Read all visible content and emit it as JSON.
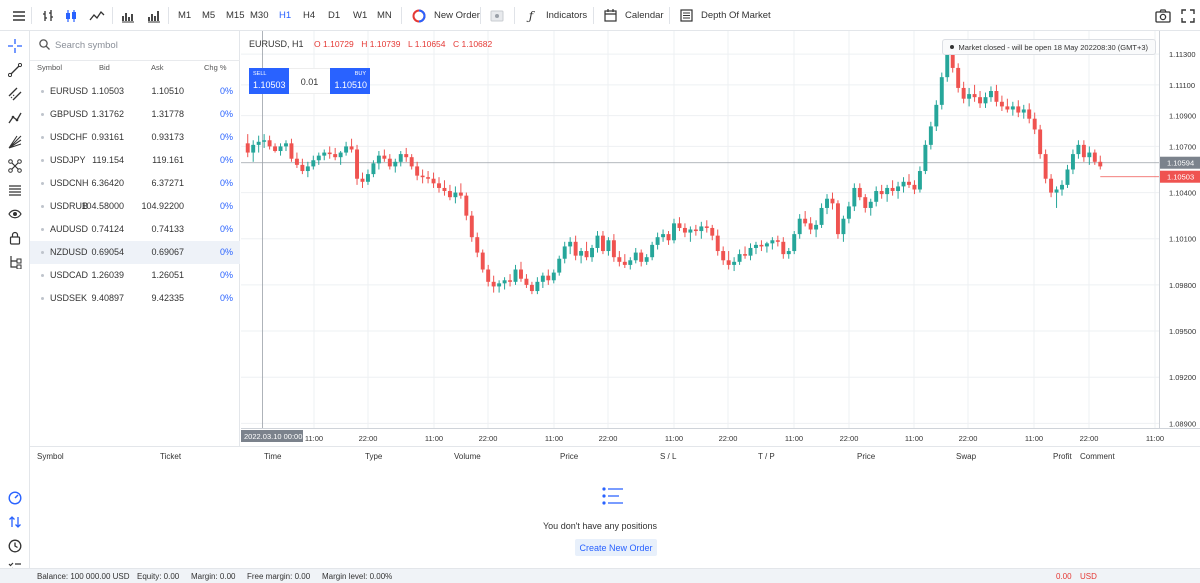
{
  "toolbar": {
    "timeframes": [
      "M1",
      "M5",
      "M15",
      "M30",
      "H1",
      "H4",
      "D1",
      "W1",
      "MN"
    ],
    "active_timeframe": "H1",
    "new_order_label": "New Order",
    "indicators_label": "Indicators",
    "calendar_label": "Calendar",
    "depth_label": "Depth Of Market"
  },
  "search": {
    "placeholder": "Search symbol"
  },
  "watchlist": {
    "headers": {
      "symbol": "Symbol",
      "bid": "Bid",
      "ask": "Ask",
      "chg": "Chg %"
    },
    "selected_symbol": "NZDUSD",
    "rows": [
      {
        "symbol": "EURUSD",
        "bid": "1.10503",
        "ask": "1.10510",
        "chg": "0%"
      },
      {
        "symbol": "GBPUSD",
        "bid": "1.31762",
        "ask": "1.31778",
        "chg": "0%"
      },
      {
        "symbol": "USDCHF",
        "bid": "0.93161",
        "ask": "0.93173",
        "chg": "0%"
      },
      {
        "symbol": "USDJPY",
        "bid": "119.154",
        "ask": "119.161",
        "chg": "0%"
      },
      {
        "symbol": "USDCNH",
        "bid": "6.36420",
        "ask": "6.37271",
        "chg": "0%"
      },
      {
        "symbol": "USDRUB",
        "bid": "104.58000",
        "ask": "104.92200",
        "chg": "0%"
      },
      {
        "symbol": "AUDUSD",
        "bid": "0.74124",
        "ask": "0.74133",
        "chg": "0%"
      },
      {
        "symbol": "NZDUSD",
        "bid": "0.69054",
        "ask": "0.69067",
        "chg": "0%"
      },
      {
        "symbol": "USDCAD",
        "bid": "1.26039",
        "ask": "1.26051",
        "chg": "0%"
      },
      {
        "symbol": "USDSEK",
        "bid": "9.40897",
        "ask": "9.42335",
        "chg": "0%"
      }
    ]
  },
  "chart": {
    "symbol_title": "EURUSD, H1",
    "ohlc": {
      "o": "O 1.10729",
      "h": "H 1.10739",
      "l": "L 1.10654",
      "c": "C 1.10682"
    },
    "market_status": "Market closed - will be open 18 May 202208:30 (GMT+3)",
    "sell_label": "SELL",
    "sell_price": "1.10503",
    "buy_label": "BUY",
    "buy_price": "1.10510",
    "volume": "0.01",
    "crosshair_date": "2022.03.10 00:00",
    "crosshair_price": "1.10594",
    "last_price": "1.10503"
  },
  "chart_data": {
    "type": "candlestick",
    "symbol": "EURUSD",
    "timeframe": "H1",
    "y_ticks": [
      "1.11300",
      "1.11100",
      "1.10900",
      "1.10700",
      "1.10400",
      "1.10100",
      "1.09800",
      "1.09500",
      "1.09200",
      "1.08900"
    ],
    "x_ticks": [
      "11:00",
      "22:00",
      "11:00",
      "22:00",
      "11:00",
      "22:00",
      "11:00",
      "22:00",
      "11:00",
      "22:00",
      "11:00",
      "22:00",
      "11:00",
      "22:00",
      "11:00"
    ],
    "ylim": [
      1.0887,
      1.1145
    ],
    "candles": [
      {
        "o": 1.1072,
        "h": 1.1078,
        "l": 1.1063,
        "c": 1.1066
      },
      {
        "o": 1.1066,
        "h": 1.1074,
        "l": 1.106,
        "c": 1.1071
      },
      {
        "o": 1.1071,
        "h": 1.1077,
        "l": 1.1066,
        "c": 1.1073
      },
      {
        "o": 1.1073,
        "h": 1.1078,
        "l": 1.1069,
        "c": 1.1074
      },
      {
        "o": 1.1074,
        "h": 1.1077,
        "l": 1.1068,
        "c": 1.107
      },
      {
        "o": 1.107,
        "h": 1.1072,
        "l": 1.1066,
        "c": 1.1067
      },
      {
        "o": 1.1067,
        "h": 1.1072,
        "l": 1.1064,
        "c": 1.107
      },
      {
        "o": 1.107,
        "h": 1.1074,
        "l": 1.1067,
        "c": 1.1072
      },
      {
        "o": 1.1072,
        "h": 1.1075,
        "l": 1.106,
        "c": 1.1062
      },
      {
        "o": 1.1062,
        "h": 1.1066,
        "l": 1.1056,
        "c": 1.1058
      },
      {
        "o": 1.1058,
        "h": 1.1062,
        "l": 1.1052,
        "c": 1.1054
      },
      {
        "o": 1.1054,
        "h": 1.106,
        "l": 1.105,
        "c": 1.1057
      },
      {
        "o": 1.1057,
        "h": 1.1064,
        "l": 1.1055,
        "c": 1.1061
      },
      {
        "o": 1.1061,
        "h": 1.1066,
        "l": 1.1058,
        "c": 1.1064
      },
      {
        "o": 1.1064,
        "h": 1.1068,
        "l": 1.1061,
        "c": 1.1066
      },
      {
        "o": 1.1066,
        "h": 1.107,
        "l": 1.1062,
        "c": 1.1065
      },
      {
        "o": 1.1065,
        "h": 1.1069,
        "l": 1.1061,
        "c": 1.1063
      },
      {
        "o": 1.1063,
        "h": 1.1067,
        "l": 1.1058,
        "c": 1.1066
      },
      {
        "o": 1.1066,
        "h": 1.1073,
        "l": 1.1064,
        "c": 1.107
      },
      {
        "o": 1.107,
        "h": 1.1075,
        "l": 1.1066,
        "c": 1.1068
      },
      {
        "o": 1.1068,
        "h": 1.1071,
        "l": 1.1045,
        "c": 1.1049
      },
      {
        "o": 1.1049,
        "h": 1.1053,
        "l": 1.1043,
        "c": 1.1047
      },
      {
        "o": 1.1047,
        "h": 1.1055,
        "l": 1.1045,
        "c": 1.1052
      },
      {
        "o": 1.1052,
        "h": 1.1061,
        "l": 1.105,
        "c": 1.1059
      },
      {
        "o": 1.1059,
        "h": 1.1067,
        "l": 1.1055,
        "c": 1.1064
      },
      {
        "o": 1.1064,
        "h": 1.1068,
        "l": 1.106,
        "c": 1.1062
      },
      {
        "o": 1.1062,
        "h": 1.1065,
        "l": 1.1055,
        "c": 1.1057
      },
      {
        "o": 1.1057,
        "h": 1.1062,
        "l": 1.1053,
        "c": 1.106
      },
      {
        "o": 1.106,
        "h": 1.1067,
        "l": 1.1057,
        "c": 1.1065
      },
      {
        "o": 1.1065,
        "h": 1.1069,
        "l": 1.106,
        "c": 1.1063
      },
      {
        "o": 1.1063,
        "h": 1.1065,
        "l": 1.1055,
        "c": 1.1057
      },
      {
        "o": 1.1057,
        "h": 1.106,
        "l": 1.1048,
        "c": 1.1051
      },
      {
        "o": 1.1051,
        "h": 1.1055,
        "l": 1.1046,
        "c": 1.105
      },
      {
        "o": 1.105,
        "h": 1.1054,
        "l": 1.1046,
        "c": 1.1049
      },
      {
        "o": 1.1049,
        "h": 1.1053,
        "l": 1.1043,
        "c": 1.1046
      },
      {
        "o": 1.1046,
        "h": 1.105,
        "l": 1.104,
        "c": 1.1043
      },
      {
        "o": 1.1043,
        "h": 1.1048,
        "l": 1.1038,
        "c": 1.1041
      },
      {
        "o": 1.1041,
        "h": 1.1045,
        "l": 1.1035,
        "c": 1.1037
      },
      {
        "o": 1.1037,
        "h": 1.1044,
        "l": 1.1033,
        "c": 1.104
      },
      {
        "o": 1.104,
        "h": 1.1046,
        "l": 1.1036,
        "c": 1.1038
      },
      {
        "o": 1.1038,
        "h": 1.104,
        "l": 1.1022,
        "c": 1.1025
      },
      {
        "o": 1.1025,
        "h": 1.1028,
        "l": 1.1008,
        "c": 1.1011
      },
      {
        "o": 1.1011,
        "h": 1.1014,
        "l": 1.0998,
        "c": 1.1001
      },
      {
        "o": 1.1001,
        "h": 1.1003,
        "l": 1.0988,
        "c": 1.099
      },
      {
        "o": 1.099,
        "h": 1.0993,
        "l": 1.0979,
        "c": 1.0982
      },
      {
        "o": 1.0982,
        "h": 1.0986,
        "l": 1.0975,
        "c": 1.0979
      },
      {
        "o": 1.0979,
        "h": 1.0983,
        "l": 1.0975,
        "c": 1.0981
      },
      {
        "o": 1.0981,
        "h": 1.0985,
        "l": 1.0977,
        "c": 1.0983
      },
      {
        "o": 1.0983,
        "h": 1.0987,
        "l": 1.0979,
        "c": 1.0982
      },
      {
        "o": 1.0982,
        "h": 1.0993,
        "l": 1.098,
        "c": 1.099
      },
      {
        "o": 1.099,
        "h": 1.0995,
        "l": 1.0982,
        "c": 1.0984
      },
      {
        "o": 1.0984,
        "h": 1.0987,
        "l": 1.0978,
        "c": 1.098
      },
      {
        "o": 1.098,
        "h": 1.0982,
        "l": 1.0974,
        "c": 1.0976
      },
      {
        "o": 1.0976,
        "h": 1.0985,
        "l": 1.0974,
        "c": 1.0982
      },
      {
        "o": 1.0982,
        "h": 1.0988,
        "l": 1.0978,
        "c": 1.0986
      },
      {
        "o": 1.0986,
        "h": 1.099,
        "l": 1.098,
        "c": 1.0983
      },
      {
        "o": 1.0983,
        "h": 1.099,
        "l": 1.0981,
        "c": 1.0988
      },
      {
        "o": 1.0988,
        "h": 1.0999,
        "l": 1.0986,
        "c": 1.0997
      },
      {
        "o": 1.0997,
        "h": 1.1008,
        "l": 1.0994,
        "c": 1.1005
      },
      {
        "o": 1.1005,
        "h": 1.1011,
        "l": 1.1,
        "c": 1.1008
      },
      {
        "o": 1.1008,
        "h": 1.1012,
        "l": 1.0996,
        "c": 1.0999
      },
      {
        "o": 1.0999,
        "h": 1.1004,
        "l": 1.0994,
        "c": 1.1002
      },
      {
        "o": 1.1002,
        "h": 1.1008,
        "l": 1.0996,
        "c": 1.0998
      },
      {
        "o": 1.0998,
        "h": 1.1006,
        "l": 1.0995,
        "c": 1.1004
      },
      {
        "o": 1.1004,
        "h": 1.1015,
        "l": 1.1001,
        "c": 1.1012
      },
      {
        "o": 1.1012,
        "h": 1.1015,
        "l": 1.1,
        "c": 1.1002
      },
      {
        "o": 1.1002,
        "h": 1.1011,
        "l": 1.0999,
        "c": 1.1009
      },
      {
        "o": 1.1009,
        "h": 1.1013,
        "l": 1.0995,
        "c": 1.0998
      },
      {
        "o": 1.0998,
        "h": 1.1002,
        "l": 1.0992,
        "c": 1.0995
      },
      {
        "o": 1.0995,
        "h": 1.1,
        "l": 1.0991,
        "c": 1.0993
      },
      {
        "o": 1.0993,
        "h": 1.0998,
        "l": 1.099,
        "c": 1.0996
      },
      {
        "o": 1.0996,
        "h": 1.1004,
        "l": 1.0994,
        "c": 1.1001
      },
      {
        "o": 1.1001,
        "h": 1.1003,
        "l": 1.0992,
        "c": 1.0995
      },
      {
        "o": 1.0995,
        "h": 1.1,
        "l": 1.0993,
        "c": 1.0998
      },
      {
        "o": 1.0998,
        "h": 1.1008,
        "l": 1.0996,
        "c": 1.1006
      },
      {
        "o": 1.1006,
        "h": 1.1014,
        "l": 1.1003,
        "c": 1.1011
      },
      {
        "o": 1.1011,
        "h": 1.1016,
        "l": 1.1008,
        "c": 1.1013
      },
      {
        "o": 1.1013,
        "h": 1.1015,
        "l": 1.1006,
        "c": 1.1009
      },
      {
        "o": 1.1009,
        "h": 1.1023,
        "l": 1.1007,
        "c": 1.102
      },
      {
        "o": 1.102,
        "h": 1.1024,
        "l": 1.1015,
        "c": 1.1017
      },
      {
        "o": 1.1017,
        "h": 1.102,
        "l": 1.1011,
        "c": 1.1014
      },
      {
        "o": 1.1014,
        "h": 1.1018,
        "l": 1.1008,
        "c": 1.1016
      },
      {
        "o": 1.1016,
        "h": 1.1019,
        "l": 1.1012,
        "c": 1.1015
      },
      {
        "o": 1.1015,
        "h": 1.1021,
        "l": 1.101,
        "c": 1.1018
      },
      {
        "o": 1.1018,
        "h": 1.1022,
        "l": 1.1014,
        "c": 1.1017
      },
      {
        "o": 1.1017,
        "h": 1.1019,
        "l": 1.1009,
        "c": 1.1012
      },
      {
        "o": 1.1012,
        "h": 1.1016,
        "l": 1.0999,
        "c": 1.1002
      },
      {
        "o": 1.1002,
        "h": 1.1005,
        "l": 1.0993,
        "c": 1.0996
      },
      {
        "o": 1.0996,
        "h": 1.1002,
        "l": 1.099,
        "c": 1.0993
      },
      {
        "o": 1.0993,
        "h": 1.0998,
        "l": 1.0989,
        "c": 1.0995
      },
      {
        "o": 1.0995,
        "h": 1.1003,
        "l": 1.0993,
        "c": 1.1
      },
      {
        "o": 1.1,
        "h": 1.1005,
        "l": 1.0997,
        "c": 1.0999
      },
      {
        "o": 1.0999,
        "h": 1.1007,
        "l": 1.0996,
        "c": 1.1004
      },
      {
        "o": 1.1004,
        "h": 1.1008,
        "l": 1.1,
        "c": 1.1006
      },
      {
        "o": 1.1006,
        "h": 1.1009,
        "l": 1.1002,
        "c": 1.1005
      },
      {
        "o": 1.1005,
        "h": 1.1008,
        "l": 1.1001,
        "c": 1.1007
      },
      {
        "o": 1.1007,
        "h": 1.1011,
        "l": 1.1003,
        "c": 1.1009
      },
      {
        "o": 1.1009,
        "h": 1.1012,
        "l": 1.1005,
        "c": 1.1008
      },
      {
        "o": 1.1008,
        "h": 1.1011,
        "l": 1.0997,
        "c": 1.1
      },
      {
        "o": 1.1,
        "h": 1.1004,
        "l": 1.0997,
        "c": 1.1002
      },
      {
        "o": 1.1002,
        "h": 1.1015,
        "l": 1.1,
        "c": 1.1013
      },
      {
        "o": 1.1013,
        "h": 1.1026,
        "l": 1.101,
        "c": 1.1023
      },
      {
        "o": 1.1023,
        "h": 1.1028,
        "l": 1.1018,
        "c": 1.102
      },
      {
        "o": 1.102,
        "h": 1.1024,
        "l": 1.1013,
        "c": 1.1016
      },
      {
        "o": 1.1016,
        "h": 1.1022,
        "l": 1.1011,
        "c": 1.1019
      },
      {
        "o": 1.1019,
        "h": 1.1033,
        "l": 1.1017,
        "c": 1.103
      },
      {
        "o": 1.103,
        "h": 1.1039,
        "l": 1.1026,
        "c": 1.1036
      },
      {
        "o": 1.1036,
        "h": 1.104,
        "l": 1.1029,
        "c": 1.1033
      },
      {
        "o": 1.1033,
        "h": 1.1035,
        "l": 1.101,
        "c": 1.1013
      },
      {
        "o": 1.1013,
        "h": 1.1025,
        "l": 1.1008,
        "c": 1.1023
      },
      {
        "o": 1.1023,
        "h": 1.1034,
        "l": 1.102,
        "c": 1.1031
      },
      {
        "o": 1.1031,
        "h": 1.1046,
        "l": 1.1028,
        "c": 1.1043
      },
      {
        "o": 1.1043,
        "h": 1.1046,
        "l": 1.1035,
        "c": 1.1037
      },
      {
        "o": 1.1037,
        "h": 1.1039,
        "l": 1.1027,
        "c": 1.103
      },
      {
        "o": 1.103,
        "h": 1.1036,
        "l": 1.1025,
        "c": 1.1034
      },
      {
        "o": 1.1034,
        "h": 1.1044,
        "l": 1.1031,
        "c": 1.1041
      },
      {
        "o": 1.1041,
        "h": 1.1045,
        "l": 1.1036,
        "c": 1.1039
      },
      {
        "o": 1.1039,
        "h": 1.1045,
        "l": 1.1034,
        "c": 1.1043
      },
      {
        "o": 1.1043,
        "h": 1.1048,
        "l": 1.1038,
        "c": 1.1041
      },
      {
        "o": 1.1041,
        "h": 1.1047,
        "l": 1.1036,
        "c": 1.1044
      },
      {
        "o": 1.1044,
        "h": 1.105,
        "l": 1.104,
        "c": 1.1047
      },
      {
        "o": 1.1047,
        "h": 1.1052,
        "l": 1.1043,
        "c": 1.1045
      },
      {
        "o": 1.1045,
        "h": 1.1048,
        "l": 1.1039,
        "c": 1.1042
      },
      {
        "o": 1.1042,
        "h": 1.1057,
        "l": 1.104,
        "c": 1.1054
      },
      {
        "o": 1.1054,
        "h": 1.1074,
        "l": 1.1052,
        "c": 1.1071
      },
      {
        "o": 1.1071,
        "h": 1.1086,
        "l": 1.1068,
        "c": 1.1083
      },
      {
        "o": 1.1083,
        "h": 1.11,
        "l": 1.108,
        "c": 1.1097
      },
      {
        "o": 1.1097,
        "h": 1.1118,
        "l": 1.1094,
        "c": 1.1115
      },
      {
        "o": 1.1115,
        "h": 1.1136,
        "l": 1.1112,
        "c": 1.1132
      },
      {
        "o": 1.1132,
        "h": 1.1138,
        "l": 1.1118,
        "c": 1.1121
      },
      {
        "o": 1.1121,
        "h": 1.1124,
        "l": 1.1105,
        "c": 1.1108
      },
      {
        "o": 1.1108,
        "h": 1.1112,
        "l": 1.1098,
        "c": 1.1101
      },
      {
        "o": 1.1101,
        "h": 1.1108,
        "l": 1.1096,
        "c": 1.1104
      },
      {
        "o": 1.1104,
        "h": 1.111,
        "l": 1.1099,
        "c": 1.1102
      },
      {
        "o": 1.1102,
        "h": 1.1106,
        "l": 1.1095,
        "c": 1.1098
      },
      {
        "o": 1.1098,
        "h": 1.1105,
        "l": 1.1095,
        "c": 1.1102
      },
      {
        "o": 1.1102,
        "h": 1.1109,
        "l": 1.1099,
        "c": 1.1106
      },
      {
        "o": 1.1106,
        "h": 1.111,
        "l": 1.1096,
        "c": 1.1099
      },
      {
        "o": 1.1099,
        "h": 1.1103,
        "l": 1.1093,
        "c": 1.1096
      },
      {
        "o": 1.1096,
        "h": 1.1101,
        "l": 1.1092,
        "c": 1.1094
      },
      {
        "o": 1.1094,
        "h": 1.1099,
        "l": 1.109,
        "c": 1.1096
      },
      {
        "o": 1.1096,
        "h": 1.11,
        "l": 1.1089,
        "c": 1.1092
      },
      {
        "o": 1.1092,
        "h": 1.1097,
        "l": 1.1088,
        "c": 1.1094
      },
      {
        "o": 1.1094,
        "h": 1.1098,
        "l": 1.1085,
        "c": 1.1088
      },
      {
        "o": 1.1088,
        "h": 1.1092,
        "l": 1.1078,
        "c": 1.1081
      },
      {
        "o": 1.1081,
        "h": 1.1084,
        "l": 1.1062,
        "c": 1.1065
      },
      {
        "o": 1.1065,
        "h": 1.1068,
        "l": 1.1046,
        "c": 1.1049
      },
      {
        "o": 1.1049,
        "h": 1.1052,
        "l": 1.1037,
        "c": 1.104
      },
      {
        "o": 1.104,
        "h": 1.1044,
        "l": 1.103,
        "c": 1.1042
      },
      {
        "o": 1.1042,
        "h": 1.1048,
        "l": 1.1038,
        "c": 1.1045
      },
      {
        "o": 1.1045,
        "h": 1.1058,
        "l": 1.1043,
        "c": 1.1055
      },
      {
        "o": 1.1055,
        "h": 1.1068,
        "l": 1.1052,
        "c": 1.1065
      },
      {
        "o": 1.1065,
        "h": 1.1074,
        "l": 1.1062,
        "c": 1.1071
      },
      {
        "o": 1.1071,
        "h": 1.1074,
        "l": 1.106,
        "c": 1.1063
      },
      {
        "o": 1.1063,
        "h": 1.107,
        "l": 1.1058,
        "c": 1.1066
      },
      {
        "o": 1.1066,
        "h": 1.1068,
        "l": 1.1058,
        "c": 1.106
      },
      {
        "o": 1.106,
        "h": 1.1064,
        "l": 1.1055,
        "c": 1.1057
      }
    ]
  },
  "positions": {
    "columns": [
      "Symbol",
      "Ticket",
      "Time",
      "Type",
      "Volume",
      "Price",
      "S / L",
      "T / P",
      "Price",
      "Swap",
      "Profit",
      "Comment"
    ],
    "empty_text": "You don't have any positions",
    "create_button": "Create New Order"
  },
  "status": {
    "balance": "Balance: 100 000.00 USD",
    "equity": "Equity: 0.00",
    "margin": "Margin: 0.00",
    "free_margin": "Free margin: 0.00",
    "margin_level": "Margin level: 0.00%",
    "pnl": "0.00",
    "currency": "USD",
    "pnl_color": "#e53935"
  },
  "colors": {
    "accent": "#2962ff",
    "bull": "#26a69a",
    "bear": "#ef5350"
  }
}
